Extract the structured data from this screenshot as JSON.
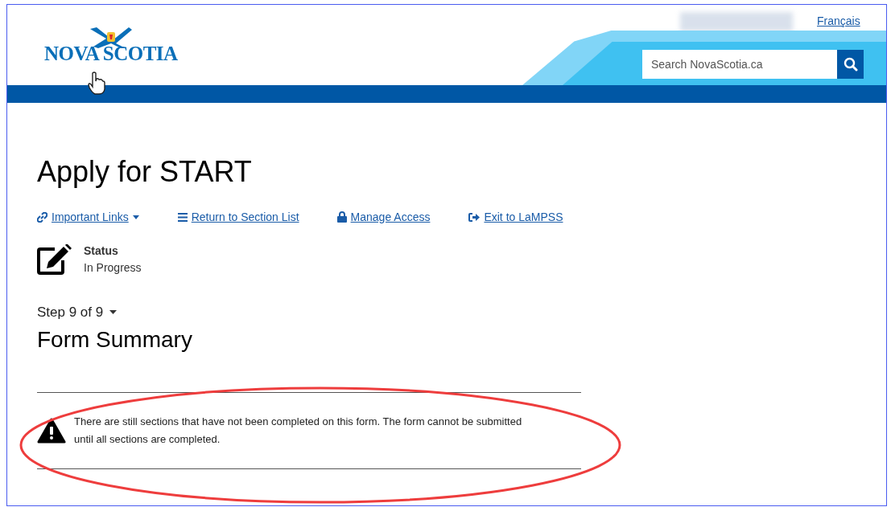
{
  "header": {
    "logo": "NOVA SCOTIA",
    "language_link": "Français",
    "search": {
      "placeholder": "Search NovaScotia.ca"
    }
  },
  "page": {
    "title": "Apply for START",
    "links": [
      {
        "kind": "chain",
        "label": "Important Links",
        "dropdown": true
      },
      {
        "kind": "list",
        "label": "Return to Section List",
        "dropdown": false
      },
      {
        "kind": "lock",
        "label": "Manage Access",
        "dropdown": false
      },
      {
        "kind": "exit",
        "label": "Exit to LaMPSS",
        "dropdown": false
      }
    ],
    "status": {
      "label": "Status",
      "value": "In Progress"
    },
    "step": "Step 9 of 9",
    "heading": "Form Summary",
    "warning": "There are still sections that have not been completed on this form. The form cannot be submitted until all sections are completed."
  }
}
